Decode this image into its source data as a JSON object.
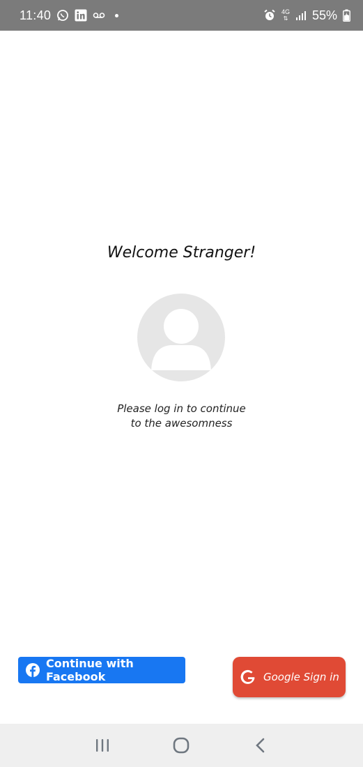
{
  "status_bar": {
    "time": "11:40",
    "battery": "55%",
    "network": "4G",
    "icons": [
      "whatsapp-icon",
      "linkedin-icon",
      "voicemail-icon",
      "notification-dot-icon",
      "alarm-icon",
      "network-4g-icon",
      "signal-icon",
      "battery-icon"
    ]
  },
  "welcome": {
    "title": "Welcome Stranger!",
    "message_line1": "Please log in to continue",
    "message_line2": "to the awesomness"
  },
  "buttons": {
    "facebook_label": "Continue with Facebook",
    "google_label": "Google Sign in"
  },
  "nav_bar": {
    "icons": [
      "recent-apps-icon",
      "home-icon",
      "back-icon"
    ]
  },
  "colors": {
    "status_bar": "#7b7b7b",
    "facebook": "#1877f2",
    "google": "#e04a35",
    "avatar_bg": "#e6e6e6",
    "nav_bar": "#efefef"
  }
}
